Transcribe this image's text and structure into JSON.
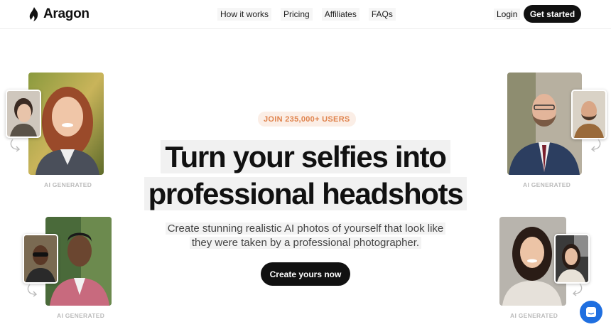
{
  "header": {
    "brand": "Aragon",
    "nav": [
      "How it works",
      "Pricing",
      "Affiliates",
      "FAQs"
    ],
    "login": "Login",
    "cta": "Get started"
  },
  "hero": {
    "badge": "JOIN 235,000+ USERS",
    "headline_line1": "Turn your selfies into",
    "headline_line2": "professional headshots",
    "sub_line1": "Create stunning realistic AI photos of yourself that look like",
    "sub_line2": "they were taken by a professional photographer.",
    "cta": "Create yours now"
  },
  "cards": {
    "ai_label": "AI GENERATED"
  },
  "colors": {
    "accent_badge_bg": "#fbeee6",
    "accent_badge_text": "#e0844e",
    "button_dark": "#111111",
    "chat_blue": "#1f6fe0"
  }
}
